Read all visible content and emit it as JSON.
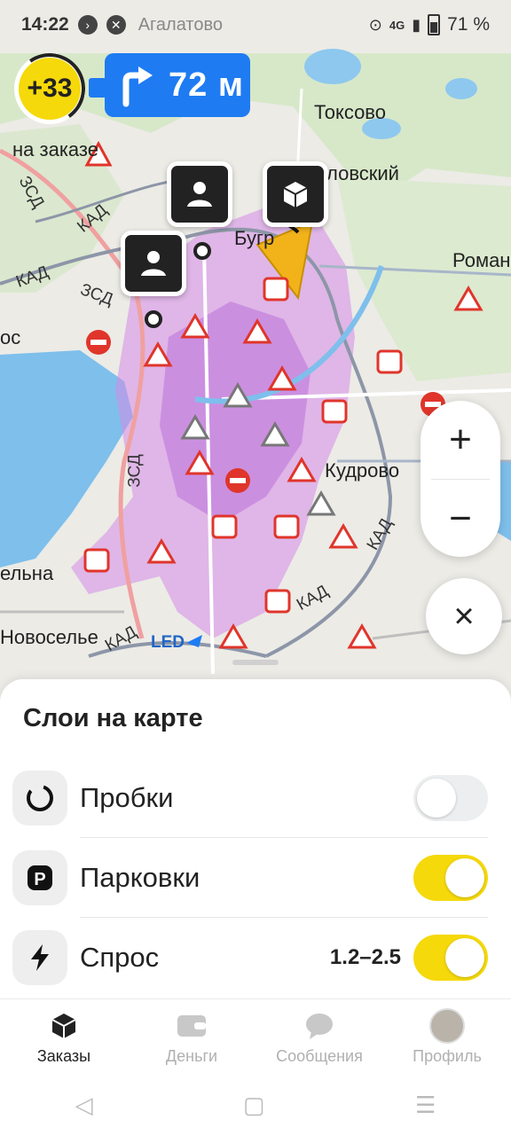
{
  "status": {
    "time": "14:22",
    "location": "Агалатово",
    "network": "4G",
    "battery": "71 %"
  },
  "score": {
    "value": "+33"
  },
  "navigation": {
    "distance": "72 м"
  },
  "map": {
    "labels": {
      "toksovo": "Токсово",
      "na_zakaze": "на заказе",
      "lovsky": "ловский",
      "romanov": "Романов",
      "kudrovo": "Кудрово",
      "novoselye": "Новоселье",
      "elna": "ельна",
      "bugry": "Бугр",
      "led": "LED",
      "os": "ос",
      "kad": "КАД",
      "zsd": "ЗСД"
    }
  },
  "zoom": {
    "plus": "+",
    "minus": "−"
  },
  "close": {
    "label": "×"
  },
  "layers": {
    "title": "Слои на карте",
    "items": [
      {
        "label": "Пробки",
        "enabled": false,
        "extra": ""
      },
      {
        "label": "Парковки",
        "enabled": true,
        "extra": ""
      },
      {
        "label": "Спрос",
        "enabled": true,
        "extra": "1.2–2.5"
      }
    ]
  },
  "tabs": [
    {
      "label": "Заказы",
      "active": true
    },
    {
      "label": "Деньги",
      "active": false
    },
    {
      "label": "Сообщения",
      "active": false
    },
    {
      "label": "Профиль",
      "active": false
    }
  ],
  "colors": {
    "accent": "#f5d90a",
    "nav_blue": "#1e7bf2",
    "demand": "#c070e0"
  }
}
